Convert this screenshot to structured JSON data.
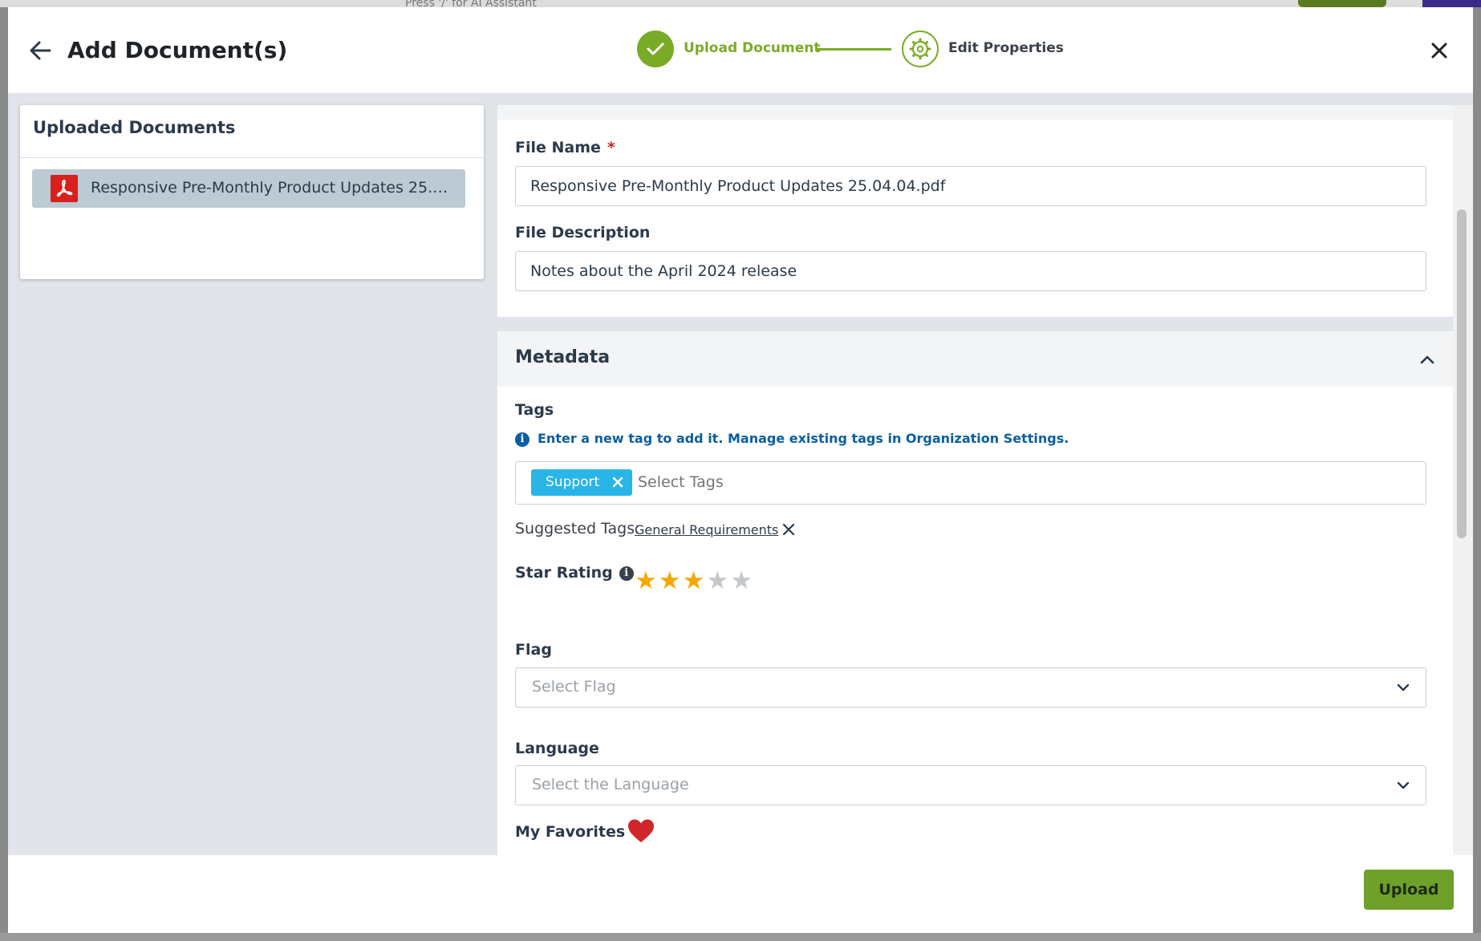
{
  "background": {
    "search_hint": "Press '/' for AI Assistant"
  },
  "header": {
    "title": "Add Document(s)",
    "steps": [
      {
        "label": "Upload Document",
        "state": "complete"
      },
      {
        "label": "Edit Properties",
        "state": "current"
      }
    ]
  },
  "uploaded": {
    "title": "Uploaded Documents",
    "items": [
      {
        "name": "Responsive Pre-Monthly Product Updates 25.04.04.pdf",
        "icon": "pdf-icon"
      }
    ]
  },
  "form": {
    "file_name_label": "File Name",
    "required_mark": "*",
    "file_name_value": "Responsive Pre-Monthly Product Updates 25.04.04.pdf",
    "file_description_label": "File Description",
    "file_description_value": "Notes about the April 2024 release"
  },
  "metadata": {
    "title": "Metadata",
    "expanded": true,
    "tags_label": "Tags",
    "tags_info": "Enter a new tag to add it. Manage existing tags in Organization Settings.",
    "tags": [
      "Support"
    ],
    "tags_placeholder": "Select Tags",
    "suggested_label": "Suggested Tags:",
    "suggested_tags": [
      "General Requirements"
    ],
    "star_rating_label": "Star Rating",
    "star_rating": 3,
    "star_max": 5,
    "flag_label": "Flag",
    "flag_placeholder": "Select Flag",
    "language_label": "Language",
    "language_placeholder": "Select the Language",
    "favorites_label": "My Favorites",
    "favorite": true
  },
  "footer": {
    "upload_label": "Upload"
  },
  "colors": {
    "accent_green": "#7aab26",
    "tag_chip": "#29b5e8",
    "star_on": "#f5a800",
    "star_off": "#c5c8cb",
    "heart": "#d0262b",
    "pdf_red": "#d8201c",
    "info_blue": "#0a5ea3"
  }
}
